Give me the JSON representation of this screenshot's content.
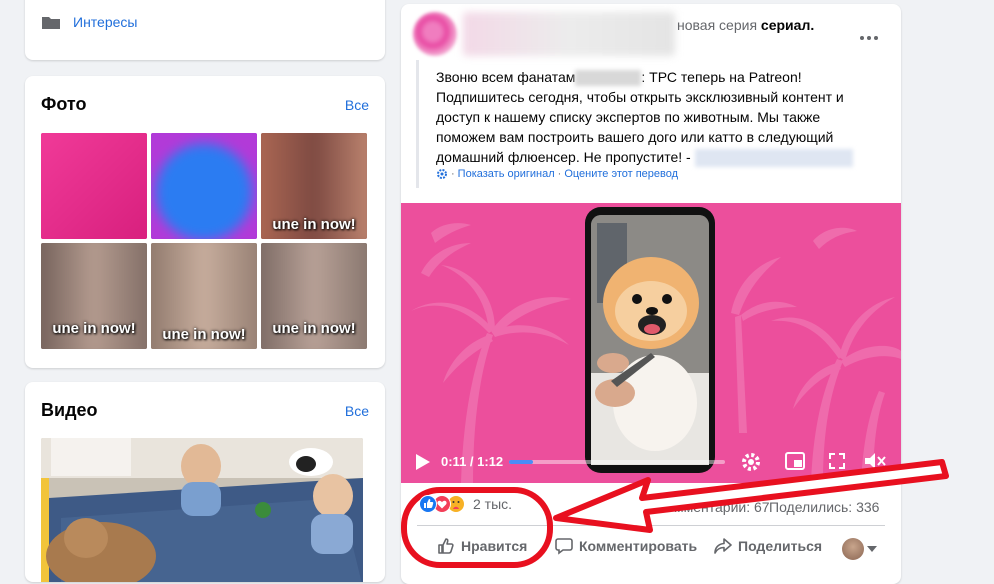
{
  "sidebar": {
    "interests_label": "Интересы",
    "photos": {
      "title": "Фото",
      "all_link": "Все",
      "captions": [
        "",
        "",
        "une in now!",
        "une in now!",
        "une in now!",
        "une in now!"
      ]
    },
    "video": {
      "title": "Видео",
      "all_link": "Все"
    }
  },
  "post": {
    "header_suffix_plain": "новая серия ",
    "header_suffix_bold": "сериал.",
    "more_icon": "ellipsis-horizontal-icon",
    "text_line1_a": "Звоню всем фанатам",
    "text_line1_b": ": ТРС теперь на Patreon!",
    "text_line2": "Подпишитесь сегодня, чтобы открыть эксклюзивный контент и",
    "text_line3": "доступ к нашему списку экспертов по животным. Мы также",
    "text_line4": "поможем вам построить вашего дого или катто в следующий",
    "text_line5": "домашний флюенсер. Не пропустите! -",
    "translate_show_original": "Показать оригинал",
    "translate_rate": "Оцените этот перевод",
    "video": {
      "time": "0:11 / 1:12",
      "progress": 0.11
    },
    "reactions_count": "2 тыс.",
    "comments_text": "мментарии: 67",
    "shares_text": "Поделились: 336",
    "actions": {
      "like": "Нравится",
      "comment": "Комментировать",
      "share": "Поделиться"
    }
  },
  "colors": {
    "accent": "#216fdb",
    "annotation": "#e8101f",
    "video_bg": "#ec4f9c"
  }
}
